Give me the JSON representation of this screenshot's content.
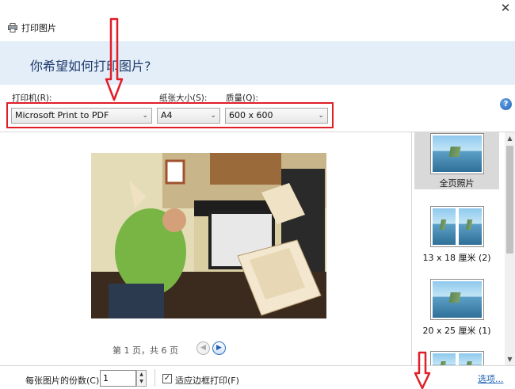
{
  "window": {
    "title": "打印图片",
    "close_symbol": "✕",
    "icon": "printer-icon"
  },
  "header": {
    "question": "你希望如何打印图片?"
  },
  "settings": {
    "printer": {
      "label": "打印机(R):",
      "value": "Microsoft Print to PDF"
    },
    "paper_size": {
      "label": "纸张大小(S):",
      "value": "A4"
    },
    "quality": {
      "label": "质量(Q):",
      "value": "600 x 600"
    },
    "help_symbol": "?"
  },
  "preview": {
    "page_info": "第 1 页，共 6 页",
    "prev_symbol": "◀",
    "next_symbol": "▶"
  },
  "layouts": [
    {
      "label": "全页照片",
      "selected": true
    },
    {
      "label": "13 x 18 厘米 (2)",
      "selected": false
    },
    {
      "label": "20 x 25 厘米 (1)",
      "selected": false
    },
    {
      "label": "",
      "selected": false
    }
  ],
  "scroll": {
    "up_symbol": "▲",
    "down_symbol": "▼"
  },
  "bottom": {
    "copies_label": "每张图片的份数(C):",
    "copies_value": "1",
    "spin_up": "▲",
    "spin_down": "▼",
    "fit_label": "适应边框打印(F)",
    "fit_checked": true,
    "fit_check_symbol": "✓",
    "options_link": "选项..."
  },
  "colors": {
    "header_band": "#e4eef8",
    "annotation_red": "#e01e28",
    "link_blue": "#1d5fb4"
  }
}
